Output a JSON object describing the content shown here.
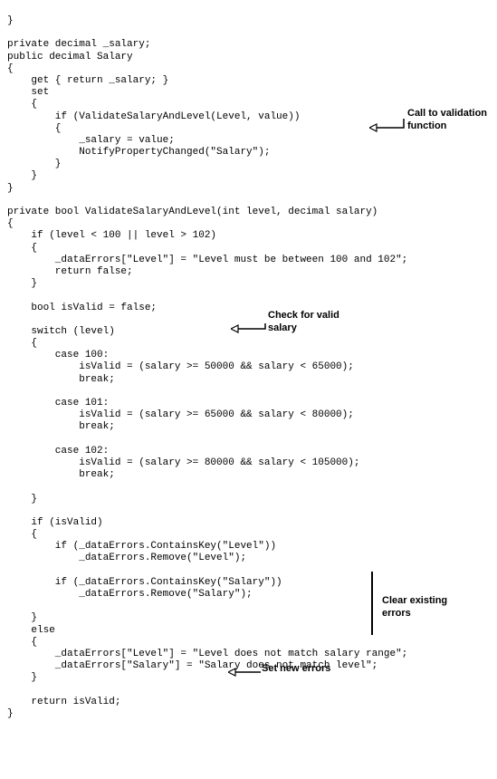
{
  "code_lines": [
    "}",
    "",
    "private decimal _salary;",
    "public decimal Salary",
    "{",
    "    get { return _salary; }",
    "    set",
    "    {",
    "        if (ValidateSalaryAndLevel(Level, value))",
    "        {",
    "            _salary = value;",
    "            NotifyPropertyChanged(\"Salary\");",
    "        }",
    "    }",
    "}",
    "",
    "private bool ValidateSalaryAndLevel(int level, decimal salary)",
    "{",
    "    if (level < 100 || level > 102)",
    "    {",
    "        _dataErrors[\"Level\"] = \"Level must be between 100 and 102\";",
    "        return false;",
    "    }",
    "",
    "    bool isValid = false;",
    "",
    "    switch (level)",
    "    {",
    "        case 100:",
    "            isValid = (salary >= 50000 && salary < 65000);",
    "            break;",
    "",
    "        case 101:",
    "            isValid = (salary >= 65000 && salary < 80000);",
    "            break;",
    "",
    "        case 102:",
    "            isValid = (salary >= 80000 && salary < 105000);",
    "            break;",
    "",
    "    }",
    "",
    "    if (isValid)",
    "    {",
    "        if (_dataErrors.ContainsKey(\"Level\"))",
    "            _dataErrors.Remove(\"Level\");",
    "",
    "        if (_dataErrors.ContainsKey(\"Salary\"))",
    "            _dataErrors.Remove(\"Salary\");",
    "",
    "    }",
    "    else",
    "    {",
    "        _dataErrors[\"Level\"] = \"Level does not match salary range\";",
    "        _dataErrors[\"Salary\"] = \"Salary does not match level\";",
    "    }",
    "",
    "    return isValid;",
    "}"
  ],
  "annotations": {
    "call_validation": "Call to validation function",
    "check_salary": "Check for valid salary",
    "clear_errors": "Clear existing errors",
    "set_new_errors": "Set new errors"
  }
}
